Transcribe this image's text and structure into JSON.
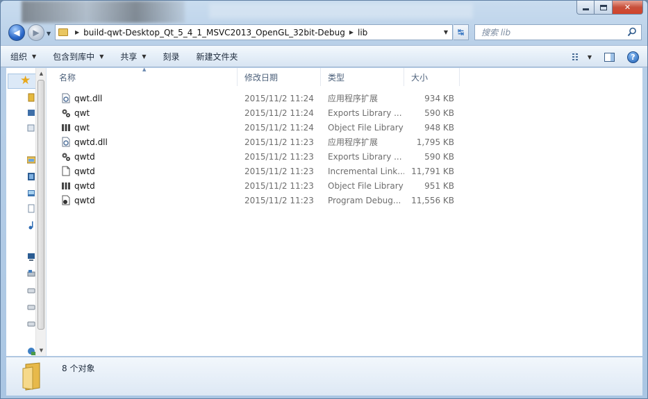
{
  "address": {
    "segments": [
      "build-qwt-Desktop_Qt_5_4_1_MSVC2013_OpenGL_32bit-Debug",
      "lib"
    ]
  },
  "search": {
    "placeholder": "搜索 lib"
  },
  "toolbar": {
    "organize": "组织",
    "include_in_library": "包含到库中",
    "share": "共享",
    "burn": "刻录",
    "new_folder": "新建文件夹"
  },
  "columns": {
    "name": "名称",
    "date": "修改日期",
    "type": "类型",
    "size": "大小"
  },
  "files": [
    {
      "name": "qwt.dll",
      "date": "2015/11/2 11:24",
      "type": "应用程序扩展",
      "size": "934 KB",
      "icon": "dll-icon"
    },
    {
      "name": "qwt",
      "date": "2015/11/2 11:24",
      "type": "Exports Library ...",
      "size": "590 KB",
      "icon": "exports-library-icon"
    },
    {
      "name": "qwt",
      "date": "2015/11/2 11:24",
      "type": "Object File Library",
      "size": "948 KB",
      "icon": "object-library-icon"
    },
    {
      "name": "qwtd.dll",
      "date": "2015/11/2 11:23",
      "type": "应用程序扩展",
      "size": "1,795 KB",
      "icon": "dll-icon"
    },
    {
      "name": "qwtd",
      "date": "2015/11/2 11:23",
      "type": "Exports Library ...",
      "size": "590 KB",
      "icon": "exports-library-icon"
    },
    {
      "name": "qwtd",
      "date": "2015/11/2 11:23",
      "type": "Incremental Link...",
      "size": "11,791 KB",
      "icon": "document-icon"
    },
    {
      "name": "qwtd",
      "date": "2015/11/2 11:23",
      "type": "Object File Library",
      "size": "951 KB",
      "icon": "object-library-icon"
    },
    {
      "name": "qwtd",
      "date": "2015/11/2 11:23",
      "type": "Program Debug...",
      "size": "11,556 KB",
      "icon": "debug-database-icon"
    }
  ],
  "status": {
    "count": "8 个对象"
  }
}
